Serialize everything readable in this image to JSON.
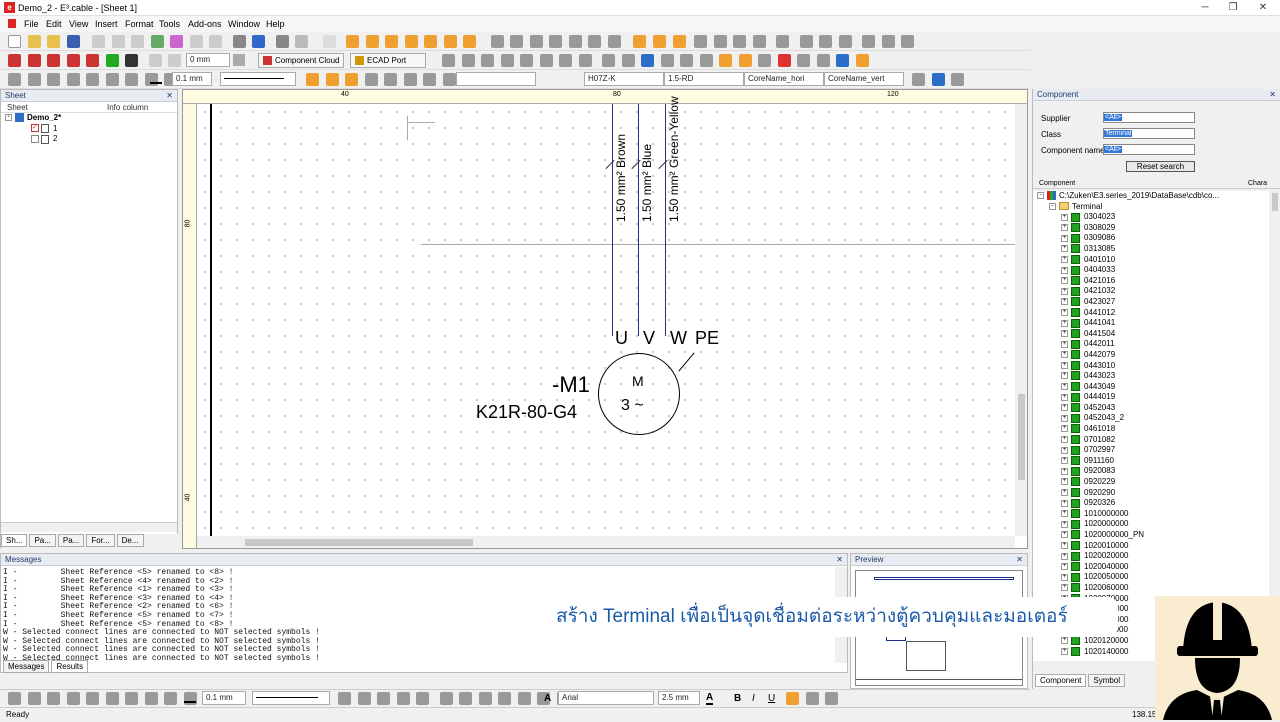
{
  "window": {
    "title": "Demo_2 - E³.cable - [Sheet 1]",
    "controls": [
      "─",
      "❐",
      "✕"
    ]
  },
  "menu": [
    "File",
    "Edit",
    "View",
    "Insert",
    "Format",
    "Tools",
    "Add-ons",
    "Window",
    "Help"
  ],
  "toolbar": {
    "line_width": "0 mm",
    "component_cloud": "Component Cloud",
    "ecad_port": "ECAD Port",
    "line_width2": "0.1 mm",
    "dd_wire": "H07Z-K",
    "dd_wire2": "1.5-RD",
    "dd_core_hori": "CoreName_hori",
    "dd_core_vert": "CoreName_vert"
  },
  "sheet_panel": {
    "title": "Sheet",
    "col_sheet": "Sheet",
    "col_info": "Info column",
    "project": "Demo_2*",
    "sheets": [
      "1",
      "2"
    ],
    "tabs": [
      "Sh...",
      "Pa...",
      "Pa...",
      "For...",
      "De..."
    ]
  },
  "canvas": {
    "ruler_top": [
      "40",
      "80",
      "120"
    ],
    "ruler_left": [
      "80",
      "40"
    ],
    "wires": [
      "1.50 mm² Brown",
      "1.50 mm² Blue",
      "1.50 mm² Green-Yellow"
    ],
    "pins": [
      "U",
      "V",
      "W",
      "PE"
    ],
    "motor_id": "-M1",
    "motor_type": "K21R-80-G4",
    "motor_symbol_top": "M",
    "motor_symbol_bottom": "3 ~"
  },
  "component_panel": {
    "title": "Component",
    "supplier_label": "Supplier",
    "supplier_value": "<All>",
    "class_label": "Class",
    "class_value": "Terminal",
    "name_label": "Component name",
    "name_value": "<All>",
    "reset_button": "Reset search",
    "col_component": "Component",
    "col_chara": "Chara",
    "db_path": "C:\\Zuken\\E3.series_2019\\DataBase\\cdb\\co...",
    "folder": "Terminal",
    "items": [
      "0304023",
      "0308029",
      "0309086",
      "0313085",
      "0401010",
      "0404033",
      "0421016",
      "0421032",
      "0423027",
      "0441012",
      "0441041",
      "0441504",
      "0442011",
      "0442079",
      "0443010",
      "0443023",
      "0443049",
      "0444019",
      "0452043",
      "0452043_2",
      "0461018",
      "0701082",
      "0702997",
      "0911160",
      "0920083",
      "0920229",
      "0920290",
      "0920326",
      "1010000000",
      "1020000000",
      "1020000000_PN",
      "1020010000",
      "1020020000",
      "1020040000",
      "1020050000",
      "1020060000",
      "1020070000",
      "1020080000",
      "1020090000",
      "1020110000",
      "1020120000",
      "1020140000"
    ],
    "tabs": [
      "Component",
      "Symbol"
    ]
  },
  "messages": {
    "title": "Messages",
    "lines": [
      "I -         Sheet Reference <5> renamed to <8> !",
      "I -         Sheet Reference <4> renamed to <2> !",
      "I -         Sheet Reference <1> renamed to <3> !",
      "I -         Sheet Reference <3> renamed to <4> !",
      "I -         Sheet Reference <2> renamed to <6> !",
      "I -         Sheet Reference <5> renamed to <7> !",
      "I -         Sheet Reference <5> renamed to <8> !",
      "W - Selected connect lines are connected to NOT selected symbols !",
      "W - Selected connect lines are connected to NOT selected symbols !",
      "W - Selected connect lines are connected to NOT selected symbols !",
      "W - Selected connect lines are connected to NOT selected symbols !"
    ],
    "tabs": [
      "Messages",
      "Results"
    ]
  },
  "preview": {
    "title": "Preview"
  },
  "bottom_toolbar": {
    "line_width": "0.1 mm",
    "font": "Arial",
    "font_size": "2.5 mm",
    "bold": "B",
    "italic": "I",
    "underline": "U"
  },
  "status": {
    "text": "Ready",
    "coord": "138.15"
  },
  "banner": {
    "text": "สร้าง Terminal เพื่อเป็นจุดเชื่อมต่อระหว่างตู้ควบคุมและมอเตอร์"
  }
}
